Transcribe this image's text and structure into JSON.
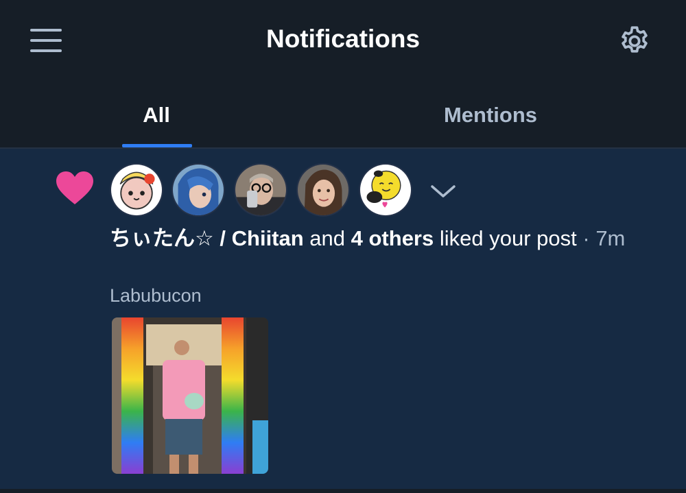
{
  "header": {
    "title": "Notifications",
    "menu_icon": "hamburger-menu-icon",
    "settings_icon": "gear-icon"
  },
  "tabs": [
    {
      "label": "All",
      "selected": true
    },
    {
      "label": "Mentions",
      "selected": false
    }
  ],
  "colors": {
    "background": "#161e27",
    "unread_row": "#162a43",
    "accent": "#2f7df4",
    "like": "#ec4899",
    "muted_text": "#aebdcf"
  },
  "notification": {
    "type_icon": "heart-icon",
    "avatars": [
      "Chiitan",
      "other-user-2",
      "other-user-3",
      "other-user-4",
      "other-user-5"
    ],
    "expand_icon": "chevron-down-icon",
    "actor": "ちぃたん☆ / Chiitan",
    "connector": " and ",
    "others": "4 others",
    "action": " liked your post",
    "separator": " · ",
    "time": "7m",
    "post_text": "Labubucon"
  }
}
